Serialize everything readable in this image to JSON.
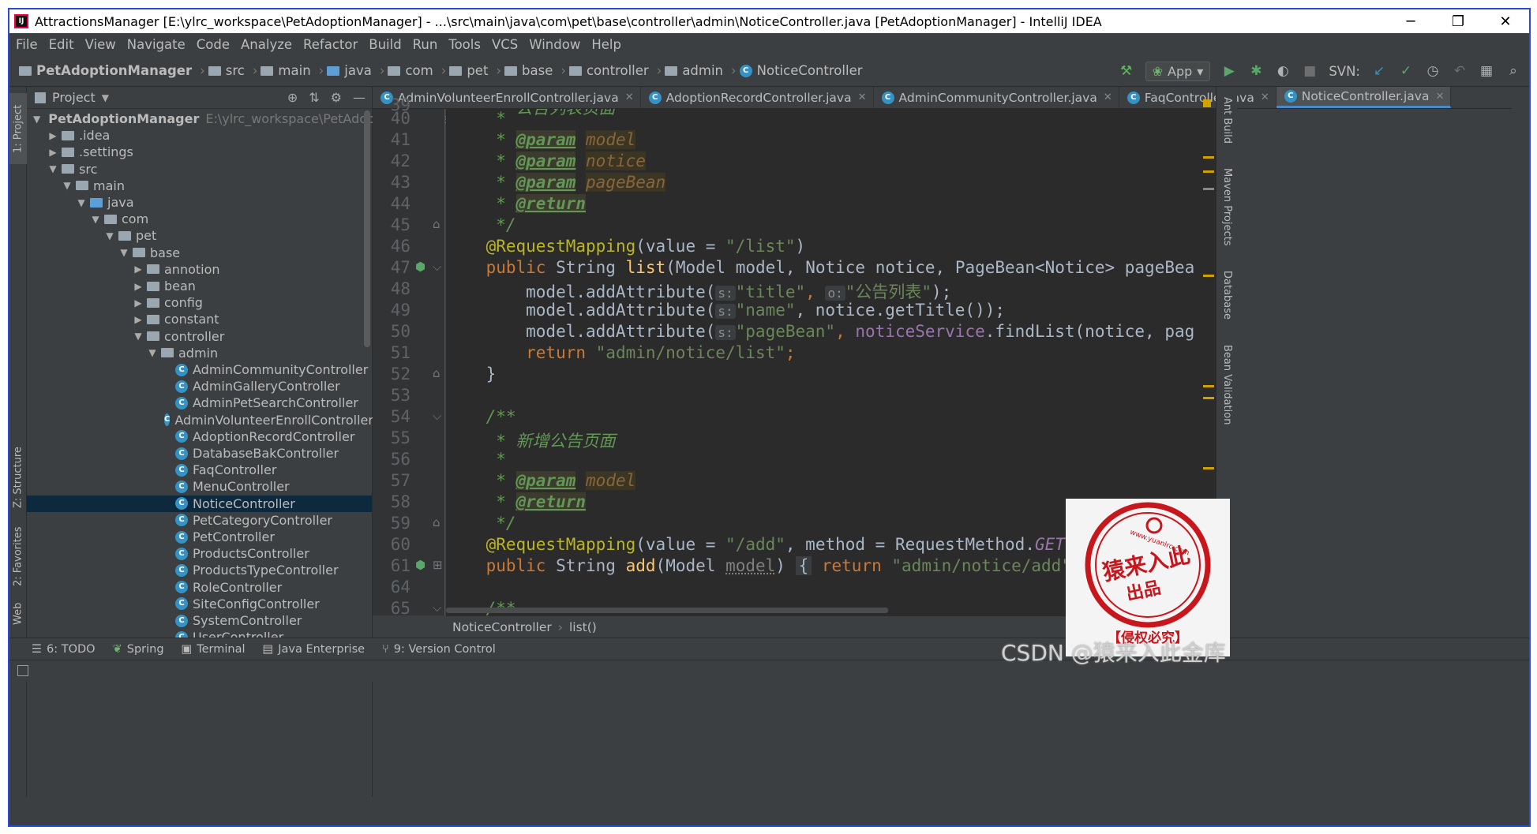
{
  "window": {
    "title": "AttractionsManager [E:\\ylrc_workspace\\PetAdoptionManager] - ...\\src\\main\\java\\com\\pet\\base\\controller\\admin\\NoticeController.java [PetAdoptionManager] - IntelliJ IDEA",
    "minimize": "─",
    "maximize": "❐",
    "close": "✕"
  },
  "menu": [
    "File",
    "Edit",
    "View",
    "Navigate",
    "Code",
    "Analyze",
    "Refactor",
    "Build",
    "Run",
    "Tools",
    "VCS",
    "Window",
    "Help"
  ],
  "navbar": {
    "crumbs": [
      "PetAdoptionManager",
      "src",
      "main",
      "java",
      "com",
      "pet",
      "base",
      "controller",
      "admin",
      "NoticeController"
    ],
    "run_config": "App",
    "svn_label": "SVN:"
  },
  "left_strip": {
    "project": "1: Project",
    "structure": "Z: Structure",
    "favorites": "2: Favorites",
    "web": "Web"
  },
  "project": {
    "header": "Project",
    "tree": [
      {
        "label": "PetAdoptionManager",
        "hint": "E:\\ylrc_workspace\\PetAdoptionManager",
        "depth": 0,
        "arrow": "▼",
        "type": "module"
      },
      {
        "label": ".idea",
        "depth": 1,
        "arrow": "▶",
        "type": "folder"
      },
      {
        "label": ".settings",
        "depth": 1,
        "arrow": "▶",
        "type": "folder"
      },
      {
        "label": "src",
        "depth": 1,
        "arrow": "▼",
        "type": "folder"
      },
      {
        "label": "main",
        "depth": 2,
        "arrow": "▼",
        "type": "folder"
      },
      {
        "label": "java",
        "depth": 3,
        "arrow": "▼",
        "type": "source"
      },
      {
        "label": "com",
        "depth": 4,
        "arrow": "▼",
        "type": "folder"
      },
      {
        "label": "pet",
        "depth": 5,
        "arrow": "▼",
        "type": "folder"
      },
      {
        "label": "base",
        "depth": 6,
        "arrow": "▼",
        "type": "folder"
      },
      {
        "label": "annotion",
        "depth": 7,
        "arrow": "▶",
        "type": "folder"
      },
      {
        "label": "bean",
        "depth": 7,
        "arrow": "▶",
        "type": "folder"
      },
      {
        "label": "config",
        "depth": 7,
        "arrow": "▶",
        "type": "folder"
      },
      {
        "label": "constant",
        "depth": 7,
        "arrow": "▶",
        "type": "folder"
      },
      {
        "label": "controller",
        "depth": 7,
        "arrow": "▼",
        "type": "folder"
      },
      {
        "label": "admin",
        "depth": 8,
        "arrow": "▼",
        "type": "folder"
      },
      {
        "label": "AdminCommunityController",
        "depth": 9,
        "type": "class"
      },
      {
        "label": "AdminGalleryController",
        "depth": 9,
        "type": "class"
      },
      {
        "label": "AdminPetSearchController",
        "depth": 9,
        "type": "class"
      },
      {
        "label": "AdminVolunteerEnrollController",
        "depth": 9,
        "type": "class"
      },
      {
        "label": "AdoptionRecordController",
        "depth": 9,
        "type": "class"
      },
      {
        "label": "DatabaseBakController",
        "depth": 9,
        "type": "class"
      },
      {
        "label": "FaqController",
        "depth": 9,
        "type": "class"
      },
      {
        "label": "MenuController",
        "depth": 9,
        "type": "class"
      },
      {
        "label": "NoticeController",
        "depth": 9,
        "type": "class",
        "selected": true
      },
      {
        "label": "PetCategoryController",
        "depth": 9,
        "type": "class"
      },
      {
        "label": "PetController",
        "depth": 9,
        "type": "class"
      },
      {
        "label": "ProductsController",
        "depth": 9,
        "type": "class"
      },
      {
        "label": "ProductsTypeController",
        "depth": 9,
        "type": "class"
      },
      {
        "label": "RoleController",
        "depth": 9,
        "type": "class"
      },
      {
        "label": "SiteConfigController",
        "depth": 9,
        "type": "class"
      },
      {
        "label": "SystemController",
        "depth": 9,
        "type": "class"
      },
      {
        "label": "UserController",
        "depth": 9,
        "type": "class"
      }
    ]
  },
  "tabs": [
    {
      "label": "AdminVolunteerEnrollController.java",
      "active": false
    },
    {
      "label": "AdoptionRecordController.java",
      "active": false
    },
    {
      "label": "AdminCommunityController.java",
      "active": false
    },
    {
      "label": "FaqController.java",
      "active": false
    },
    {
      "label": "NoticeController.java",
      "active": true
    }
  ],
  "editor": {
    "line_numbers": [
      "39",
      "40",
      "41",
      "42",
      "43",
      "44",
      "45",
      "46",
      "47",
      "48",
      "49",
      "50",
      "51",
      "52",
      "53",
      "54",
      "55",
      "56",
      "57",
      "58",
      "59",
      "60",
      "61",
      "64",
      "65"
    ],
    "code": {
      "l39": "     * 公告列表页面",
      "l40": "     *",
      "param_kw": "@param",
      "return_kw": "@return",
      "star": "     * ",
      "p_model": "model",
      "p_notice": "notice",
      "p_pagebean": "pageBean",
      "end_comment": "     */",
      "rm1_annot": "@RequestMapping",
      "rm1_rest": "(value = ",
      "rm1_str": "\"/list\"",
      "rm1_close": ")",
      "l47_public": "public ",
      "l47_type": "String ",
      "l47_name": "list",
      "l47_args": "(Model model, Notice notice, PageBean<Notice> pageBea",
      "add_attr": "        model.addAttribute(",
      "hint_s": "s:",
      "hint_o": "o:",
      "s_title": "\"title\"",
      "s_notice_list": "\"公告列表\"",
      "l48_end": ");",
      "s_name": "\"name\"",
      "l49_rest": ", notice.getTitle());",
      "s_pagebean": "\"pageBean\"",
      "l50_field": "noticeService",
      "l50_rest": ".findList(notice, pag",
      "l51_return": "        return ",
      "l51_str": "\"admin/notice/list\"",
      "l51_end": ";",
      "l52": "    }",
      "l54": "    /**",
      "l55": "     * 新增公告页面",
      "rm2_rest": "(value = ",
      "rm2_str": "\"/add\"",
      "rm2_method": ", method = RequestMethod.",
      "rm2_get": "GET",
      "rm2_close": ")",
      "l61_name": "add",
      "l61_args_a": "(Model ",
      "l61_args_b": "model",
      "l61_args_c": ") ",
      "l61_fold": "{",
      "l61_return": " return ",
      "l61_str": "\"admin/notice/add\"",
      "l65": "    /**"
    }
  },
  "editor_breadcrumb": {
    "class": "NoticeController",
    "method": "list()"
  },
  "right_strip": [
    "Ant Build",
    "Maven Projects",
    "Database",
    "Bean Validation"
  ],
  "bottom_tools": [
    {
      "label": "6: TODO",
      "icon": "list-icon"
    },
    {
      "label": "Spring",
      "icon": "leaf-icon"
    },
    {
      "label": "Terminal",
      "icon": "terminal-icon"
    },
    {
      "label": "Java Enterprise",
      "icon": "enterprise-icon"
    },
    {
      "label": "9: Version Control",
      "icon": "vcs-icon"
    }
  ],
  "overlay": {
    "stamp_text": "猿来入此 出品",
    "stamp_url": "www.yuanlrc.com",
    "stamp_caption": "【侵权必究】",
    "watermark": "CSDN @猿来入此金库"
  },
  "colors": {
    "background": "#2b2b2b",
    "panel": "#3c3f41",
    "selection": "#0d293e",
    "keyword": "#cc7832",
    "string": "#6a8759",
    "annotation": "#bbb529",
    "doc_comment": "#629755"
  }
}
